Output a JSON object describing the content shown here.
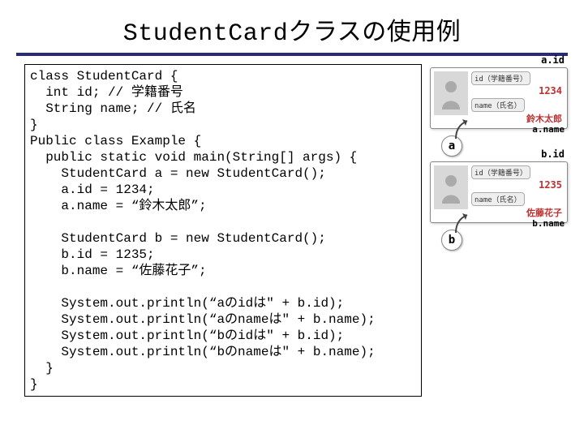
{
  "title": "StudentCardクラスの使用例",
  "code": "class StudentCard {\n  int id; // 学籍番号\n  String name; // 氏名\n}\nPublic class Example {\n  public static void main(String[] args) {\n    StudentCard a = new StudentCard();\n    a.id = 1234;\n    a.name = “鈴木太郎”;\n\n    StudentCard b = new StudentCard();\n    b.id = 1235;\n    b.name = “佐藤花子”;\n\n    System.out.println(“aのidは\" + b.id);\n    System.out.println(“aのnameは\" + b.name);\n    System.out.println(“bのidは\" + b.id);\n    System.out.println(“bのnameは\" + b.name);\n  }\n}",
  "cards": {
    "a": {
      "var": "a",
      "id_label": "a.id",
      "name_label": "a.name",
      "field_id_caption": "id（学籍番号）",
      "field_name_caption": "name（氏名）",
      "id_value": "1234",
      "name_value": "鈴木太郎"
    },
    "b": {
      "var": "b",
      "id_label": "b.id",
      "name_label": "b.name",
      "field_id_caption": "id（学籍番号）",
      "field_name_caption": "name（氏名）",
      "id_value": "1235",
      "name_value": "佐藤花子"
    }
  }
}
